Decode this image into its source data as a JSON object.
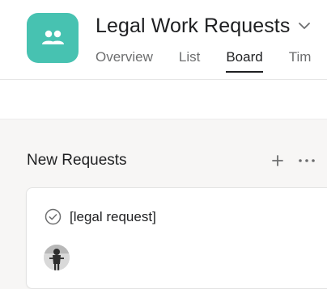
{
  "project": {
    "title": "Legal Work Requests",
    "icon": "people-icon",
    "accent_color": "#47c2b1"
  },
  "tabs": [
    {
      "label": "Overview",
      "active": false
    },
    {
      "label": "List",
      "active": false
    },
    {
      "label": "Board",
      "active": true
    },
    {
      "label": "Tim",
      "active": false
    }
  ],
  "column": {
    "title": "New Requests",
    "add_icon": "plus-icon",
    "more_icon": "more-icon"
  },
  "card": {
    "title": "[legal request]",
    "status_icon": "check-circle-icon",
    "assignee_avatar": "avatar"
  }
}
